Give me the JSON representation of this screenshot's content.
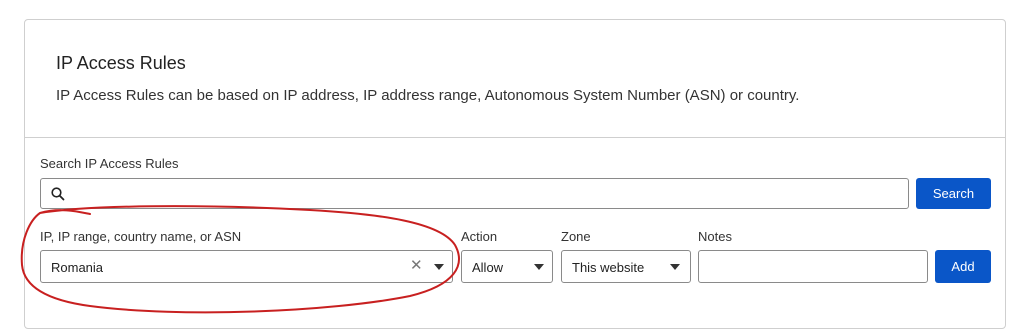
{
  "panel": {
    "title": "IP Access Rules",
    "description": "IP Access Rules can be based on IP address, IP address range, Autonomous System Number (ASN) or country."
  },
  "search": {
    "label": "Search IP Access Rules",
    "value": "",
    "placeholder": "",
    "button_label": "Search"
  },
  "rule_form": {
    "target": {
      "label": "IP, IP range, country name, or ASN",
      "value": "Romania",
      "clear_icon": "close-icon"
    },
    "action": {
      "label": "Action",
      "value": "Allow"
    },
    "zone": {
      "label": "Zone",
      "value": "This website"
    },
    "notes": {
      "label": "Notes",
      "value": ""
    },
    "add_label": "Add"
  },
  "colors": {
    "primary_button": "#0a56c8",
    "annotation_stroke": "#c82020",
    "border": "#cfcfcf"
  }
}
